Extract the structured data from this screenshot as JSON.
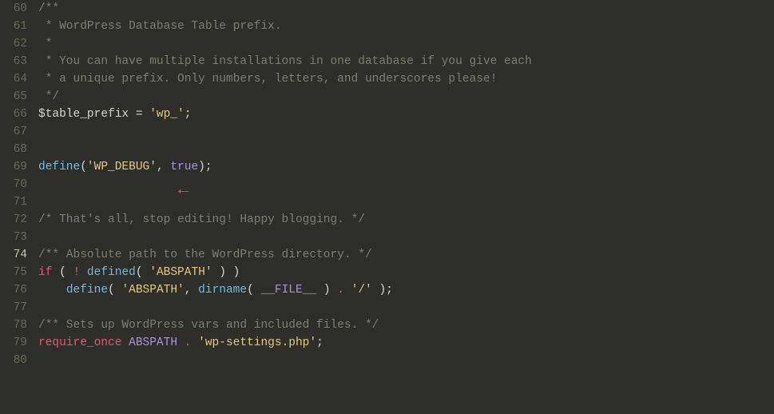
{
  "lines": {
    "n60": "60",
    "n61": "61",
    "n62": "62",
    "n63": "63",
    "n64": "64",
    "n65": "65",
    "n66": "66",
    "n67": "67",
    "n68": "68",
    "n69": "69",
    "n70": "70",
    "n71": "71",
    "n72": "72",
    "n73": "73",
    "n74": "74",
    "n75": "75",
    "n76": "76",
    "n77": "77",
    "n78": "78",
    "n79": "79",
    "n80": "80"
  },
  "code": {
    "c60": "/**",
    "c61": " * WordPress Database Table prefix.",
    "c62": " *",
    "c63": " * You can have multiple installations in one database if you give each",
    "c64": " * a unique prefix. Only numbers, letters, and underscores please!",
    "c65": " */",
    "l66_var": "$table_prefix",
    "l66_eq": " = ",
    "l66_str": "'wp_'",
    "l66_end": ";",
    "l69_fn": "define",
    "l69_p1": "(",
    "l69_s1": "'WP_DEBUG'",
    "l69_c": ", ",
    "l69_b": "true",
    "l69_p2": ")",
    "l69_e": ";",
    "c72": "/* That's all, stop editing! Happy blogging. */",
    "c74": "/** Absolute path to the WordPress directory. */",
    "l75_if": "if",
    "l75_sp1": " ( ",
    "l75_not": "!",
    "l75_sp2": " ",
    "l75_fn": "defined",
    "l75_p1": "( ",
    "l75_s": "'ABSPATH'",
    "l75_p2": " ) )",
    "l76_pad": "    ",
    "l76_fn": "define",
    "l76_p1": "( ",
    "l76_s1": "'ABSPATH'",
    "l76_c": ", ",
    "l76_fn2": "dirname",
    "l76_p2": "( ",
    "l76_cn": "__FILE__",
    "l76_p3": " ) ",
    "l76_dot": ".",
    "l76_sp": " ",
    "l76_s2": "'/'",
    "l76_p4": " );",
    "c78": "/** Sets up WordPress vars and included files. */",
    "l79_kw": "require_once",
    "l79_sp": " ",
    "l79_cn": "ABSPATH",
    "l79_sp2": " ",
    "l79_dot": ".",
    "l79_sp3": " ",
    "l79_s": "'wp-settings.php'",
    "l79_e": ";"
  },
  "arrow": "←"
}
